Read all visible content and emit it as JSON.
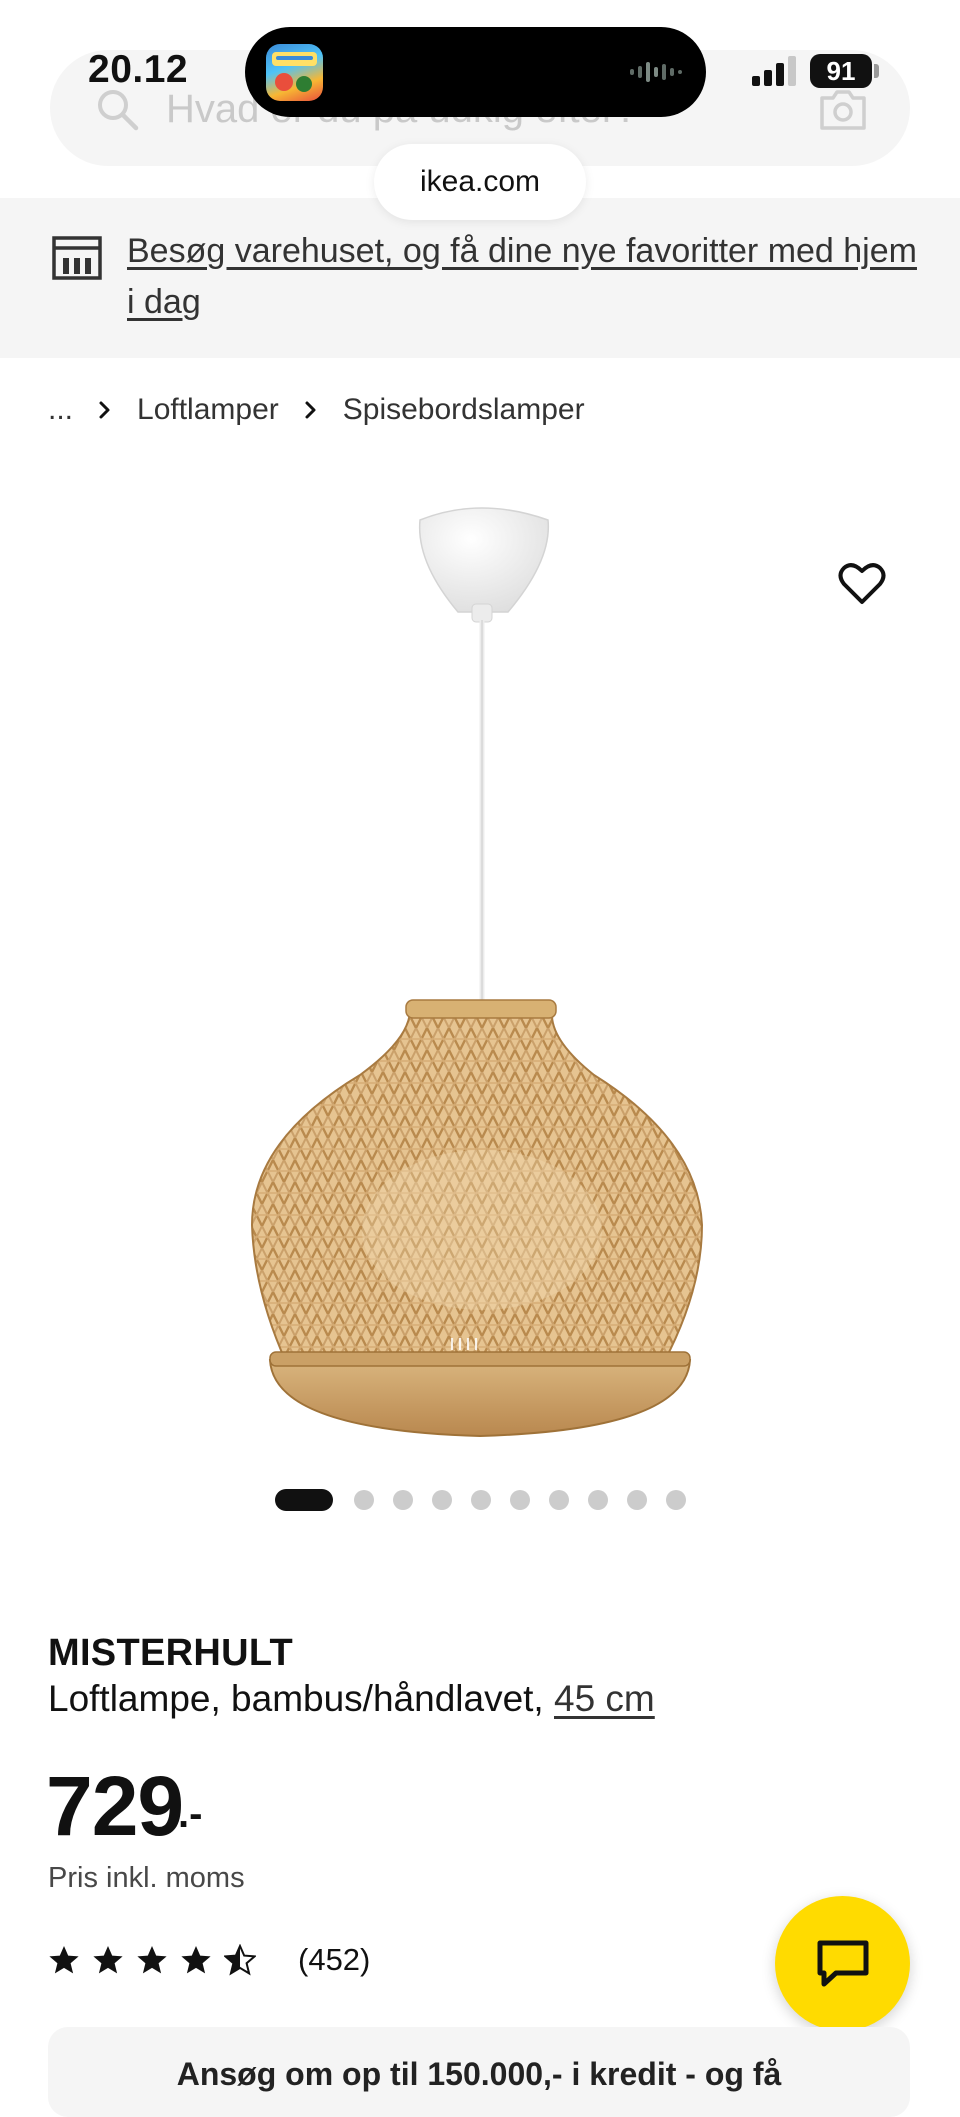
{
  "status_bar": {
    "time": "20.12",
    "battery": "91"
  },
  "search": {
    "placeholder": "Hvad er du på udkig efter?"
  },
  "browser": {
    "url": "ikea.com"
  },
  "store_banner": {
    "text": "Besøg varehuset, og få dine nye favoritter med hjem i dag"
  },
  "breadcrumb": {
    "items": [
      "...",
      "Loftlamper",
      "Spisebordslamper"
    ]
  },
  "gallery": {
    "image_count": 10,
    "active_index": 0
  },
  "product": {
    "name": "MISTERHULT",
    "description": "Loftlampe, bambus/håndlavet,",
    "size": "45 cm",
    "price": "729",
    "price_suffix": ".-",
    "price_note": "Pris inkl. moms",
    "rating_stars": 4.5,
    "rating_count": "(452)"
  },
  "credit_banner": {
    "text": "Ansøg om op til 150.000,- i kredit - og få"
  },
  "colors": {
    "chat_button": "#ffdb00",
    "banner_bg": "#f5f5f5",
    "active_dot": "#111111",
    "inactive_dot": "#cccccc"
  },
  "icons": {
    "search": "search-icon",
    "camera": "camera-icon",
    "store": "store-icon",
    "favorite": "heart-icon",
    "chat": "chat-icon",
    "rating": "star-icon"
  }
}
